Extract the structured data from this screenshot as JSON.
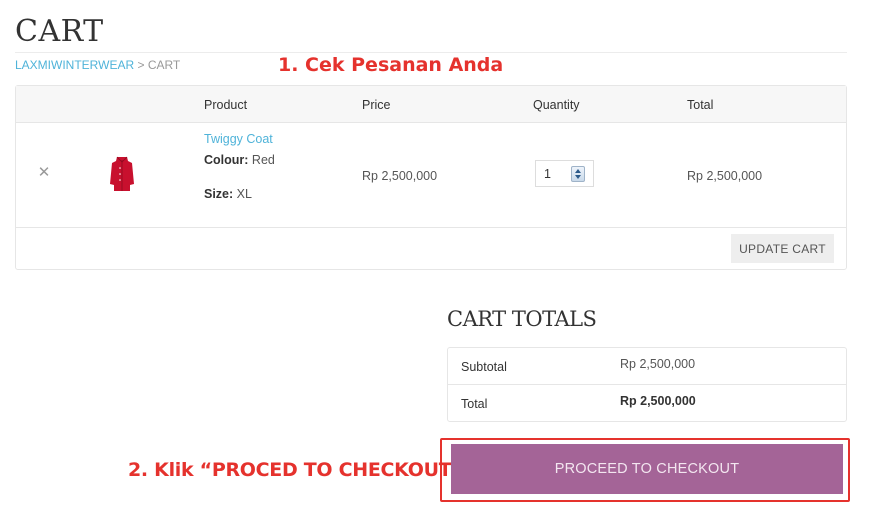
{
  "page": {
    "title": "CART",
    "breadcrumb": {
      "home": "LAXMIWINTERWEAR",
      "separator": " > ",
      "current": "CART"
    }
  },
  "annotations": {
    "step1": "1. Cek Pesanan Anda",
    "step2": "2. Klik “PROCED TO CHECKOUT",
    "color": "#e5322d"
  },
  "cart_table": {
    "headers": {
      "product": "Product",
      "price": "Price",
      "quantity": "Quantity",
      "total": "Total"
    },
    "items": [
      {
        "remove_icon": "close-icon",
        "name": "Twiggy Coat",
        "colour_label": "Colour:",
        "colour_value": "Red",
        "size_label": "Size:",
        "size_value": "XL",
        "price": "Rp 2,500,000",
        "quantity": "1",
        "total": "Rp 2,500,000",
        "thumb_color": "#c8102e"
      }
    ],
    "update_label": "UPDATE CART"
  },
  "cart_totals": {
    "title": "CART TOTALS",
    "subtotal_label": "Subtotal",
    "subtotal_value": "Rp 2,500,000",
    "total_label": "Total",
    "total_value": "Rp 2,500,000"
  },
  "checkout": {
    "label": "PROCEED TO CHECKOUT",
    "color": "#a46497"
  },
  "colors": {
    "link": "#4fb3d9"
  }
}
